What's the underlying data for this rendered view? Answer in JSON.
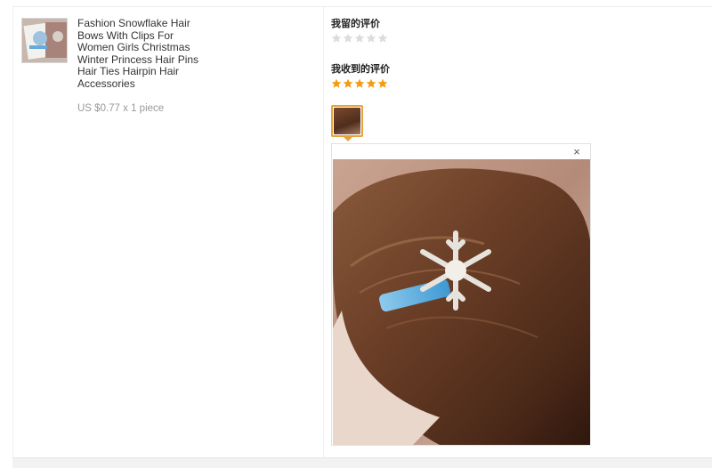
{
  "product": {
    "title": "Fashion Snowflake Hair Bows With Clips For Women Girls Christmas Winter Princess Hair Pins Hair Ties Hairpin Hair Accessories",
    "price": "US $0.77 x 1 piece",
    "thumbnail_icon": "product-thumbnail"
  },
  "reviews": {
    "my_review_label": "我留的评价",
    "my_review_stars": 0,
    "received_review_label": "我收到的评价",
    "received_review_stars": 5,
    "star_total": 5,
    "star_filled_color": "#f39c12",
    "star_empty_color": "#dcdcdc",
    "active_border_color": "#e8a33b"
  },
  "viewer": {
    "close_glyph": "×",
    "photo_description_icon": "review-photo"
  }
}
